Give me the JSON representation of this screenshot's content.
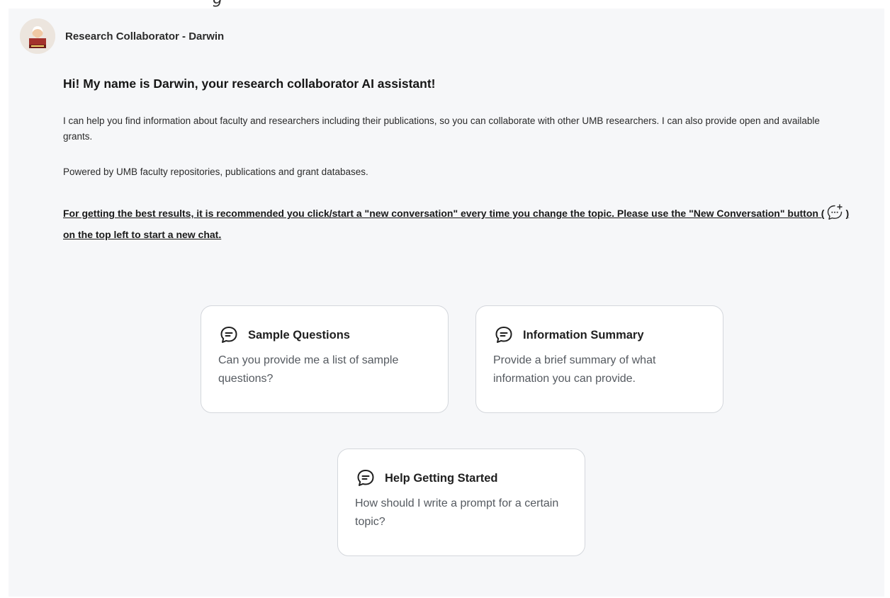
{
  "top_cut_text": "g",
  "header": {
    "title": "Research Collaborator - Darwin"
  },
  "intro": {
    "greeting": "Hi! My name is Darwin, your research collaborator AI assistant!",
    "paragraph_1": "I can help you find information about faculty and researchers including their publications, so you can collaborate with other UMB researchers. I can also provide open and available grants.",
    "paragraph_2": "Powered by UMB faculty repositories, publications and grant databases.",
    "notice_part_1": "For getting the best results, it is recommended you click/start a \"new conversation\" every time you change the topic. Please use the \"New Conversation\" button (",
    "notice_part_2": ") on the top left to start a new chat."
  },
  "cards": [
    {
      "title": "Sample Questions",
      "text": "Can you provide me a list of sample questions?"
    },
    {
      "title": "Information Summary",
      "text": "Provide a brief summary of what information you can provide."
    },
    {
      "title": "Help Getting Started",
      "text": "How should I write a prompt for a certain topic?"
    }
  ],
  "icons": {
    "avatar": "darwin-avatar-icon",
    "new_conversation": "new-conversation-icon",
    "card": "chat-bubble-icon"
  },
  "colors": {
    "panel_background": "#f6f7f9",
    "card_border": "#d4d7dc",
    "card_text": "#555a60"
  }
}
